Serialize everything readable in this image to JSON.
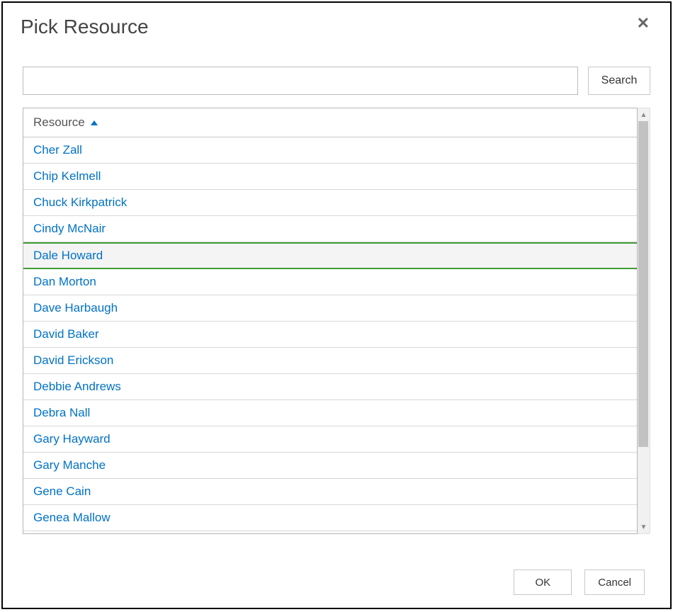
{
  "dialog": {
    "title": "Pick Resource"
  },
  "search": {
    "value": "",
    "placeholder": "",
    "button_label": "Search"
  },
  "table": {
    "header": "Resource",
    "selected_index": 4,
    "rows": [
      "Cher Zall",
      "Chip Kelmell",
      "Chuck Kirkpatrick",
      "Cindy McNair",
      "Dale Howard",
      "Dan Morton",
      "Dave Harbaugh",
      "David Baker",
      "David Erickson",
      "Debbie Andrews",
      "Debra Nall",
      "Gary Hayward",
      "Gary Manche",
      "Gene Cain",
      "Genea Mallow"
    ]
  },
  "footer": {
    "ok_label": "OK",
    "cancel_label": "Cancel"
  }
}
